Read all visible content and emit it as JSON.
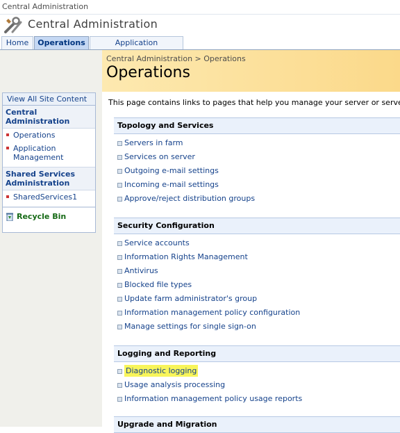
{
  "window_title": "Central Administration",
  "header": {
    "title": "Central Administration"
  },
  "tabs": [
    {
      "label": "Home"
    },
    {
      "label": "Operations"
    },
    {
      "label": "Application Management"
    }
  ],
  "breadcrumb": {
    "root": "Central Administration",
    "separator": " > ",
    "current": "Operations"
  },
  "page_title": "Operations",
  "intro": "This page contains links to pages that help you manage your server or server farm, suc",
  "nav": {
    "view_all": "View All Site Content",
    "groups": [
      {
        "label": "Central Administration",
        "items": [
          {
            "label": "Operations"
          },
          {
            "label": "Application Management"
          }
        ]
      },
      {
        "label": "Shared Services Administration",
        "items": [
          {
            "label": "SharedServices1"
          }
        ]
      }
    ],
    "recycle_bin": "Recycle Bin"
  },
  "sections": [
    {
      "title": "Topology and Services",
      "links": [
        "Servers in farm",
        "Services on server",
        "Outgoing e-mail settings",
        "Incoming e-mail settings",
        "Approve/reject distribution groups"
      ]
    },
    {
      "title": "Security Configuration",
      "links": [
        "Service accounts",
        "Information Rights Management",
        "Antivirus",
        "Blocked file types",
        "Update farm administrator's group",
        "Information management policy configuration",
        "Manage settings for single sign-on"
      ]
    },
    {
      "title": "Logging and Reporting",
      "links": [
        "Diagnostic logging",
        "Usage analysis processing",
        "Information management policy usage reports"
      ]
    },
    {
      "title": "Upgrade and Migration",
      "links": []
    }
  ],
  "highlighted_link": "Diagnostic logging",
  "colors": {
    "link": "#15428b",
    "highlight": "#f8f55a",
    "title_band": "#fbd98a",
    "section_header": "#eaf1fb"
  },
  "icons": {
    "app": "tools-icon",
    "recycle": "recycle-bin-icon",
    "bullet": "square-bullet-icon"
  }
}
